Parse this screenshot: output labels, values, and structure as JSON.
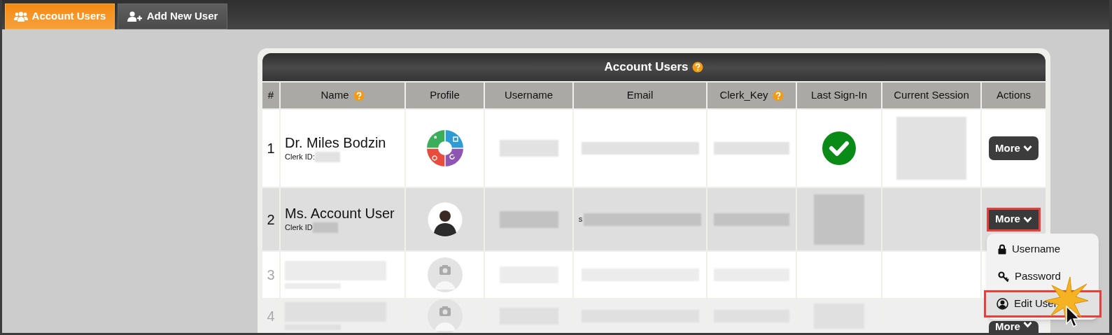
{
  "tabs": [
    {
      "label": "Account Users",
      "selected": true
    },
    {
      "label": "Add New User",
      "selected": false
    }
  ],
  "panel": {
    "title": "Account Users",
    "help": true
  },
  "columns": [
    {
      "label": "#",
      "help": false
    },
    {
      "label": "Name",
      "help": true
    },
    {
      "label": "Profile",
      "help": false
    },
    {
      "label": "Username",
      "help": false
    },
    {
      "label": "Email",
      "help": false
    },
    {
      "label": "Clerk_Key",
      "help": true
    },
    {
      "label": "Last Sign-In",
      "help": false
    },
    {
      "label": "Current Session",
      "help": false
    },
    {
      "label": "Actions",
      "help": false
    }
  ],
  "rows": [
    {
      "number": "1",
      "name": "Dr. Miles Bodzin",
      "clerk_id_label": "Clerk ID:",
      "signed_in": true,
      "action": "More",
      "active": false,
      "faded": false,
      "highlighted": false
    },
    {
      "number": "2",
      "name": "Ms. Account User",
      "clerk_id_label": "Clerk ID",
      "email_prefix": "s",
      "signed_in": false,
      "action": "More",
      "active": true,
      "faded": false,
      "highlighted": true
    },
    {
      "number": "3",
      "signed_in": false,
      "active": false,
      "faded": true
    },
    {
      "number": "4",
      "signed_in": false,
      "action": "More",
      "active": false,
      "faded": true,
      "highlighted": false
    }
  ],
  "menu": {
    "items": [
      {
        "label": "Username",
        "highlighted": false
      },
      {
        "label": "Password",
        "highlighted": false
      },
      {
        "label": "Edit User",
        "highlighted": true
      }
    ]
  }
}
